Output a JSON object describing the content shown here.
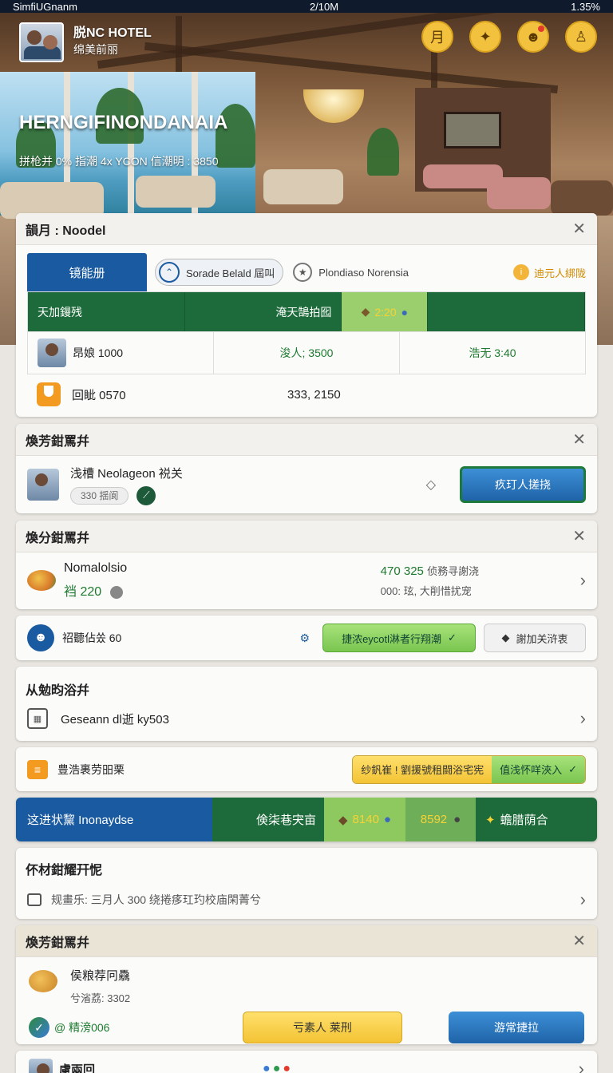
{
  "status_bar": {
    "carrier": "SimfiUGnanm",
    "time": "2/10M",
    "battery": "1.35%"
  },
  "hero": {
    "hotel_name_line1": "脱NC HOTEL",
    "hotel_name_line2": "绵美前丽",
    "title": "HERNGIFINONDANAIA",
    "subtitle": "拼枪并 0% 指潮 4x YCON 信潮明 : 3850",
    "icons": [
      "calendar-icon",
      "hotel-icon",
      "notification-user-icon",
      "profile-icon"
    ],
    "icon_glyphs": [
      "月",
      "✦",
      "☻",
      "♙"
    ]
  },
  "card1": {
    "title": "韻月 : Noodel",
    "tabs": {
      "active": "镜能册",
      "pill": "Sorade Belald 屆叫",
      "plain": "Plondiaso Norensia",
      "right": "迪元人綁陇"
    },
    "table": {
      "header": [
        "天加鏝残",
        "淹天鵠拍囮",
        "2:20"
      ],
      "row": [
        "昂娘 1000",
        "浚人; 3500",
        "浩无 3:40"
      ]
    },
    "extra_row": [
      "回眦 0570",
      "333, 2150"
    ]
  },
  "card2": {
    "title": "煥芳鉗罵幷",
    "name": "浅槽 Neolageon 裞关",
    "chip": "330 揺阆",
    "button": "疚玎人搓挠"
  },
  "card3": {
    "title": "煥分鉗罵幷",
    "item_name": "Nomalolsio",
    "item_price": "裆 220",
    "stat_value": "470 325",
    "stat_label": "侦務寻謝浇",
    "stat_sub": "000: 玹, 大削惜扰宠"
  },
  "card4": {
    "label": "祒聽佔쏬 60",
    "green_button": "捷浓eycotl淋者行翔潮",
    "grey_button": "謝加关浒衷"
  },
  "card5": {
    "title": "从勉昀浴幷",
    "item": "Geseann dl逝 ky503"
  },
  "card6": {
    "label": "豊浩裹劳昍栗",
    "split_left": "纱釩崔 ! 劉援號租闘浴宅宪",
    "split_right": "值浅怀咩浹入"
  },
  "banner": {
    "seg1": "这进状黧 Inonaydse",
    "seg2": "倹柒巷宊亩",
    "seg3": "8140",
    "seg4": "8592",
    "seg5": "蟾腊荫合"
  },
  "card7": {
    "title": "伓材鉗耀幵怩",
    "text": "规畫乐: 三月人 300 绕捲痑玒玓校庙閑菁兮"
  },
  "card8": {
    "title": "煥芳鉗罵幷",
    "item_name": "侯粮荐冋驫",
    "item_sub": "兮渻荔: 3302",
    "tag": "@ 精滂006",
    "btn_yellow": "亏素人 莱刑",
    "btn_blue": "游常捷拉"
  },
  "card9": {
    "title": "慮兩回"
  },
  "colors": {
    "primary_blue": "#1a5aa0",
    "primary_green": "#1d6b3a",
    "accent_gold": "#f2c13e"
  }
}
